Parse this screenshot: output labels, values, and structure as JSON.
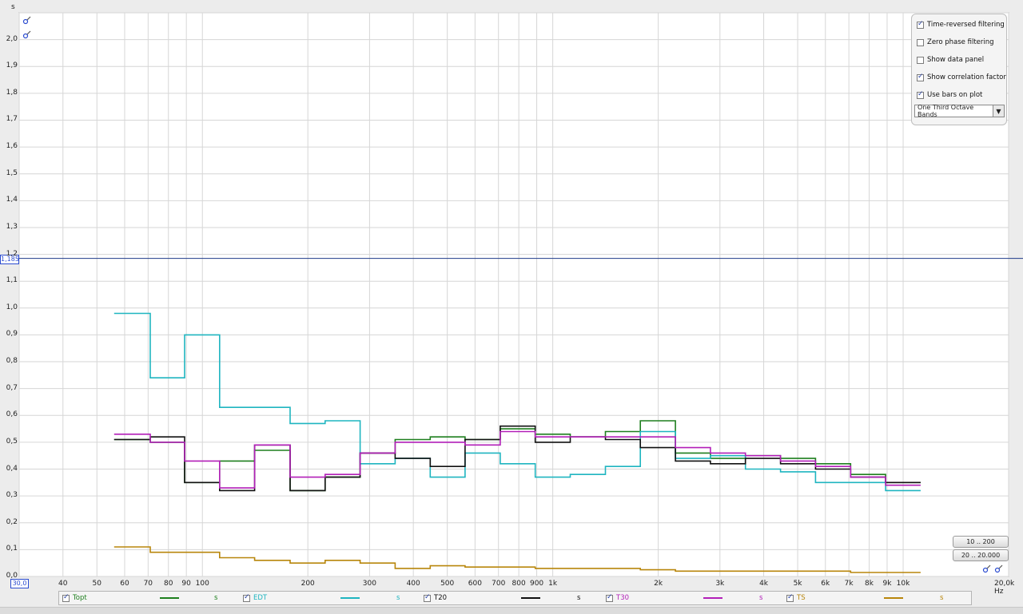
{
  "units": {
    "y": "s",
    "x": "Hz"
  },
  "x_min_label": "30,0",
  "cursor_label": "1,185",
  "options": [
    {
      "label": "Time-reversed filtering",
      "checked": true
    },
    {
      "label": "Zero phase filtering",
      "checked": false
    },
    {
      "label": "Show data panel",
      "checked": false
    },
    {
      "label": "Show correlation factor",
      "checked": true
    },
    {
      "label": "Use bars on plot",
      "checked": true
    }
  ],
  "band_select": "One Third Octave Bands",
  "range_buttons": [
    "10 .. 200",
    "20 .. 20.000"
  ],
  "legend": [
    {
      "name": "Topt",
      "color": "#1e7f1e",
      "unit": "s",
      "checked": true
    },
    {
      "name": "EDT",
      "color": "#1fb5c0",
      "unit": "s",
      "checked": true
    },
    {
      "name": "T20",
      "color": "#111111",
      "unit": "s",
      "checked": true
    },
    {
      "name": "T30",
      "color": "#b21fb8",
      "unit": "s",
      "checked": true
    },
    {
      "name": "TS",
      "color": "#b8860b",
      "unit": "s",
      "checked": true
    }
  ],
  "chart_data": {
    "type": "line",
    "x_scale": "log",
    "xlim": [
      30,
      20000
    ],
    "ylim": [
      0,
      2.1
    ],
    "grid": true,
    "y_ticks": [
      "0,0",
      "0,1",
      "0,2",
      "0,3",
      "0,4",
      "0,5",
      "0,6",
      "0,7",
      "0,8",
      "0,9",
      "1,0",
      "1,1",
      "1,2",
      "1,3",
      "1,4",
      "1,5",
      "1,6",
      "1,7",
      "1,8",
      "1,9",
      "2,0"
    ],
    "x_tick_labels": [
      {
        "v": 40,
        "t": "40"
      },
      {
        "v": 50,
        "t": "50"
      },
      {
        "v": 60,
        "t": "60"
      },
      {
        "v": 70,
        "t": "70"
      },
      {
        "v": 80,
        "t": "80"
      },
      {
        "v": 90,
        "t": "90"
      },
      {
        "v": 100,
        "t": "100"
      },
      {
        "v": 200,
        "t": "200"
      },
      {
        "v": 300,
        "t": "300"
      },
      {
        "v": 400,
        "t": "400"
      },
      {
        "v": 500,
        "t": "500"
      },
      {
        "v": 600,
        "t": "600"
      },
      {
        "v": 700,
        "t": "700"
      },
      {
        "v": 800,
        "t": "800"
      },
      {
        "v": 900,
        "t": "900"
      },
      {
        "v": 1000,
        "t": "1k"
      },
      {
        "v": 2000,
        "t": "2k"
      },
      {
        "v": 3000,
        "t": "3k"
      },
      {
        "v": 4000,
        "t": "4k"
      },
      {
        "v": 5000,
        "t": "5k"
      },
      {
        "v": 6000,
        "t": "6k"
      },
      {
        "v": 7000,
        "t": "7k"
      },
      {
        "v": 8000,
        "t": "8k"
      },
      {
        "v": 9000,
        "t": "9k"
      },
      {
        "v": 10000,
        "t": "10k"
      }
    ],
    "x_grid": [
      30,
      40,
      50,
      60,
      70,
      80,
      90,
      100,
      200,
      300,
      400,
      500,
      600,
      700,
      800,
      900,
      1000,
      2000,
      3000,
      4000,
      5000,
      6000,
      7000,
      8000,
      9000,
      10000,
      20000
    ],
    "cursor_y": 1.185,
    "band_edges": [
      56,
      71,
      89,
      112,
      141,
      178,
      224,
      282,
      355,
      447,
      562,
      708,
      891,
      1122,
      1413,
      1778,
      2239,
      2818,
      3548,
      4467,
      5623,
      7079,
      8913,
      11220
    ],
    "series": [
      {
        "name": "Topt",
        "color": "#1e7f1e",
        "values": [
          0.51,
          0.5,
          0.35,
          0.43,
          0.47,
          0.32,
          0.37,
          0.46,
          0.51,
          0.52,
          0.51,
          0.55,
          0.53,
          0.52,
          0.54,
          0.58,
          0.46,
          0.44,
          0.45,
          0.44,
          0.42,
          0.38,
          0.35
        ]
      },
      {
        "name": "EDT",
        "color": "#1fb5c0",
        "values": [
          0.98,
          0.74,
          0.9,
          0.63,
          0.63,
          0.57,
          0.58,
          0.42,
          0.44,
          0.37,
          0.46,
          0.42,
          0.37,
          0.38,
          0.41,
          0.54,
          0.44,
          0.45,
          0.4,
          0.39,
          0.35,
          0.35,
          0.32
        ]
      },
      {
        "name": "T20",
        "color": "#111111",
        "values": [
          0.51,
          0.52,
          0.35,
          0.32,
          0.49,
          0.32,
          0.37,
          0.46,
          0.44,
          0.41,
          0.51,
          0.56,
          0.5,
          0.52,
          0.51,
          0.48,
          0.43,
          0.42,
          0.44,
          0.42,
          0.4,
          0.37,
          0.35
        ]
      },
      {
        "name": "T30",
        "color": "#b21fb8",
        "values": [
          0.53,
          0.5,
          0.43,
          0.33,
          0.49,
          0.37,
          0.38,
          0.46,
          0.5,
          0.5,
          0.49,
          0.54,
          0.52,
          0.52,
          0.52,
          0.52,
          0.48,
          0.46,
          0.45,
          0.43,
          0.41,
          0.37,
          0.34
        ]
      },
      {
        "name": "TS",
        "color": "#b8860b",
        "values": [
          0.11,
          0.09,
          0.09,
          0.07,
          0.06,
          0.05,
          0.06,
          0.05,
          0.03,
          0.04,
          0.035,
          0.035,
          0.03,
          0.03,
          0.03,
          0.025,
          0.02,
          0.02,
          0.02,
          0.02,
          0.02,
          0.015,
          0.015
        ]
      }
    ]
  }
}
